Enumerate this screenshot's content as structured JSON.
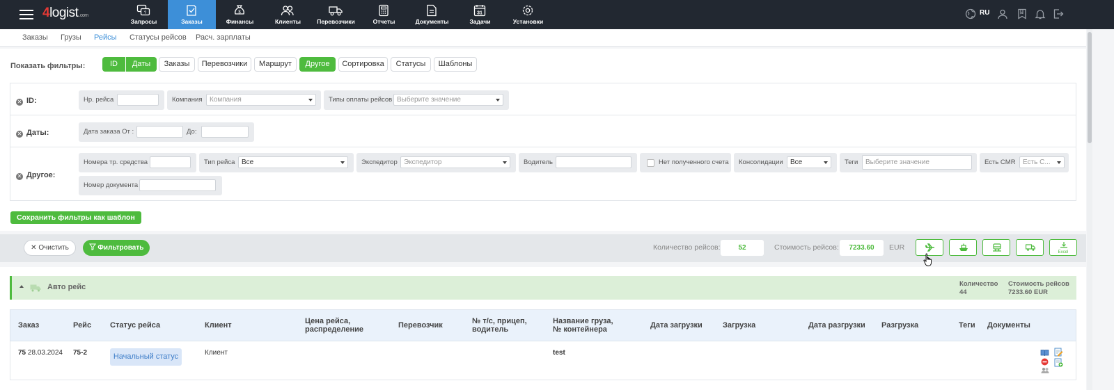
{
  "app": {
    "logo_main": "4logist",
    "logo_suffix": ".com",
    "lang": "RU",
    "accent": "#3d8fd8",
    "green": "#4ebb3e"
  },
  "nav": [
    {
      "label": "Запросы",
      "icon": "requests-icon"
    },
    {
      "label": "Заказы",
      "icon": "orders-icon",
      "active": true
    },
    {
      "label": "Финансы",
      "icon": "finance-icon"
    },
    {
      "label": "Клиенты",
      "icon": "clients-icon"
    },
    {
      "label": "Перевозчики",
      "icon": "truck-icon"
    },
    {
      "label": "Отчеты",
      "icon": "reports-icon"
    },
    {
      "label": "Документы",
      "icon": "documents-icon"
    },
    {
      "label": "Задачи",
      "icon": "calendar-icon"
    },
    {
      "label": "Установки",
      "icon": "gear-icon"
    }
  ],
  "subnav": [
    {
      "label": "Заказы"
    },
    {
      "label": "Грузы"
    },
    {
      "label": "Рейсы",
      "active": true
    },
    {
      "label": "Статусы рейсов"
    },
    {
      "label": "Расч. зарплаты"
    }
  ],
  "filters": {
    "show_label": "Показать фильтры:",
    "toggles": [
      {
        "label": "ID",
        "on": true
      },
      {
        "label": "Даты",
        "on": true
      },
      {
        "label": "Заказы",
        "on": false
      },
      {
        "label": "Перевозчики",
        "on": false
      },
      {
        "label": "Маршрут",
        "on": false
      },
      {
        "label": "Другое",
        "on": true
      },
      {
        "label": "Сортировка",
        "on": false
      },
      {
        "label": "Статусы",
        "on": false
      },
      {
        "label": "Шаблоны",
        "on": false
      }
    ],
    "id_row": {
      "label": "ID:",
      "trip_no_label": "Нр. рейса",
      "trip_no_value": "",
      "company_label": "Компания",
      "company_placeholder": "Компания",
      "paytype_label": "Типы оплаты рейсов",
      "paytype_placeholder": "Выберите значение"
    },
    "dates_row": {
      "label": "Даты:",
      "from_label": "Дата заказа От :",
      "from_value": "",
      "to_label": "До:",
      "to_value": ""
    },
    "other_row": {
      "label": "Другое:",
      "vehicle_label": "Номера тр. средства",
      "vehicle_value": "",
      "trip_type_label": "Тип рейса",
      "trip_type_value": "Все",
      "forwarder_label": "Экспедитор",
      "forwarder_placeholder": "Экспедитор",
      "driver_label": "Водитель",
      "driver_value": "",
      "no_invoice_label": "Нет полученного счета",
      "no_invoice_checked": false,
      "consolidation_label": "Консолидации",
      "consolidation_value": "Все",
      "tags_label": "Теги",
      "tags_placeholder": "Выберите значение",
      "cmr_label": "Есть CMR",
      "cmr_placeholder": "Есть С...",
      "docno_label": "Номер документа",
      "docno_value": ""
    },
    "save_template": "Сохранить фильтры как шаблон"
  },
  "actions": {
    "clear": "Очистить",
    "filter": "Фильтровать",
    "count_label": "Количество рейсов:",
    "count_value": "52",
    "cost_label": "Стоимость рейсов:",
    "cost_value": "7233.60",
    "currency": "EUR",
    "excel": "Excel"
  },
  "group": {
    "title": "Авто рейс",
    "qty_label": "Количество",
    "qty_value": "44",
    "cost_label": "Стоимость рейсов",
    "cost_value": "7233.60 EUR"
  },
  "table": {
    "columns": [
      "Заказ",
      "Рейс",
      "Статус рейса",
      "Клиент",
      "Цена рейса, распределение",
      "Перевозчик",
      "№ т/с, прицеп, водитель",
      "Название груза, № контейнера",
      "Дата загрузки",
      "Загрузка",
      "Дата разгрузки",
      "Разгрузка",
      "Теги",
      "Документы"
    ],
    "rows": [
      {
        "order_no": "75",
        "order_date": "28.03.2024",
        "trip": "75-2",
        "status": "Начальный статус",
        "client": "Клиент",
        "price": "",
        "carrier": "",
        "vehicle": "",
        "cargo": "test"
      }
    ]
  }
}
